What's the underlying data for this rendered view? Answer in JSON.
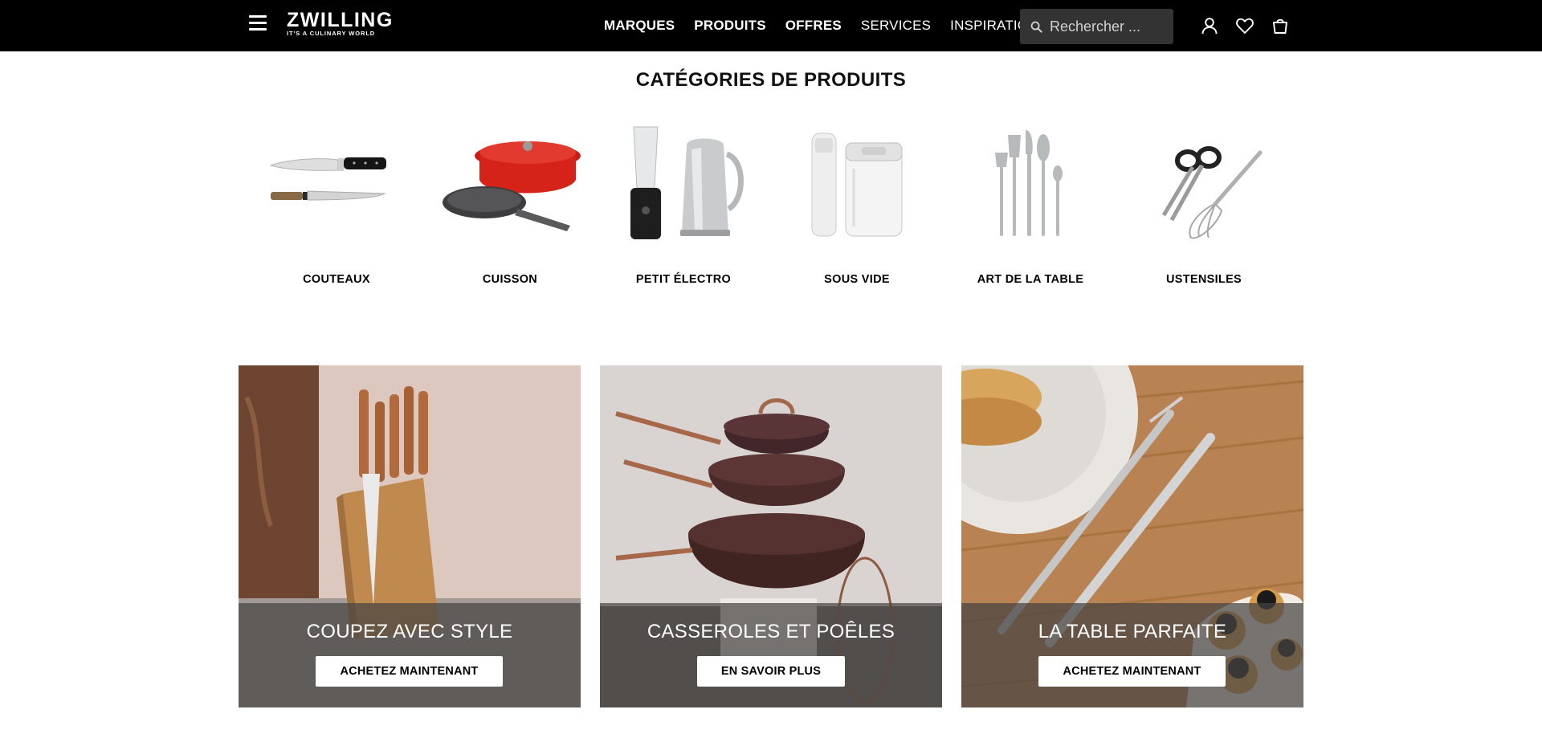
{
  "header": {
    "logo_main": "ZWILLING",
    "logo_tagline": "IT'S A CULINARY WORLD",
    "nav": [
      {
        "label": "MARQUES"
      },
      {
        "label": "PRODUITS"
      },
      {
        "label": "OFFRES"
      },
      {
        "label": "SERVICES"
      },
      {
        "label": "INSPIRATION"
      }
    ],
    "search_placeholder": "Rechercher ...",
    "background": "#000000",
    "search_background": "#333333"
  },
  "categories": {
    "title": "CATÉGORIES DE PRODUITS",
    "items": [
      {
        "label": "COUTEAUX",
        "icon": "knives-icon"
      },
      {
        "label": "CUISSON",
        "icon": "cookware-icon"
      },
      {
        "label": "PETIT ÉLECTRO",
        "icon": "small-appliances-icon"
      },
      {
        "label": "SOUS VIDE",
        "icon": "vacuum-container-icon"
      },
      {
        "label": "ART DE LA TABLE",
        "icon": "cutlery-icon"
      },
      {
        "label": "USTENSILES",
        "icon": "kitchen-tools-icon"
      }
    ]
  },
  "promos": [
    {
      "headline": "COUPEZ AVEC STYLE",
      "cta": "ACHETEZ MAINTENANT",
      "image": "knife-block-photo"
    },
    {
      "headline": "CASSEROLES ET POÊLES",
      "cta": "EN SAVOIR PLUS",
      "image": "stacked-pots-photo"
    },
    {
      "headline": "LA TABLE PARFAITE",
      "cta": "ACHETEZ MAINTENANT",
      "image": "table-setting-photo"
    }
  ]
}
